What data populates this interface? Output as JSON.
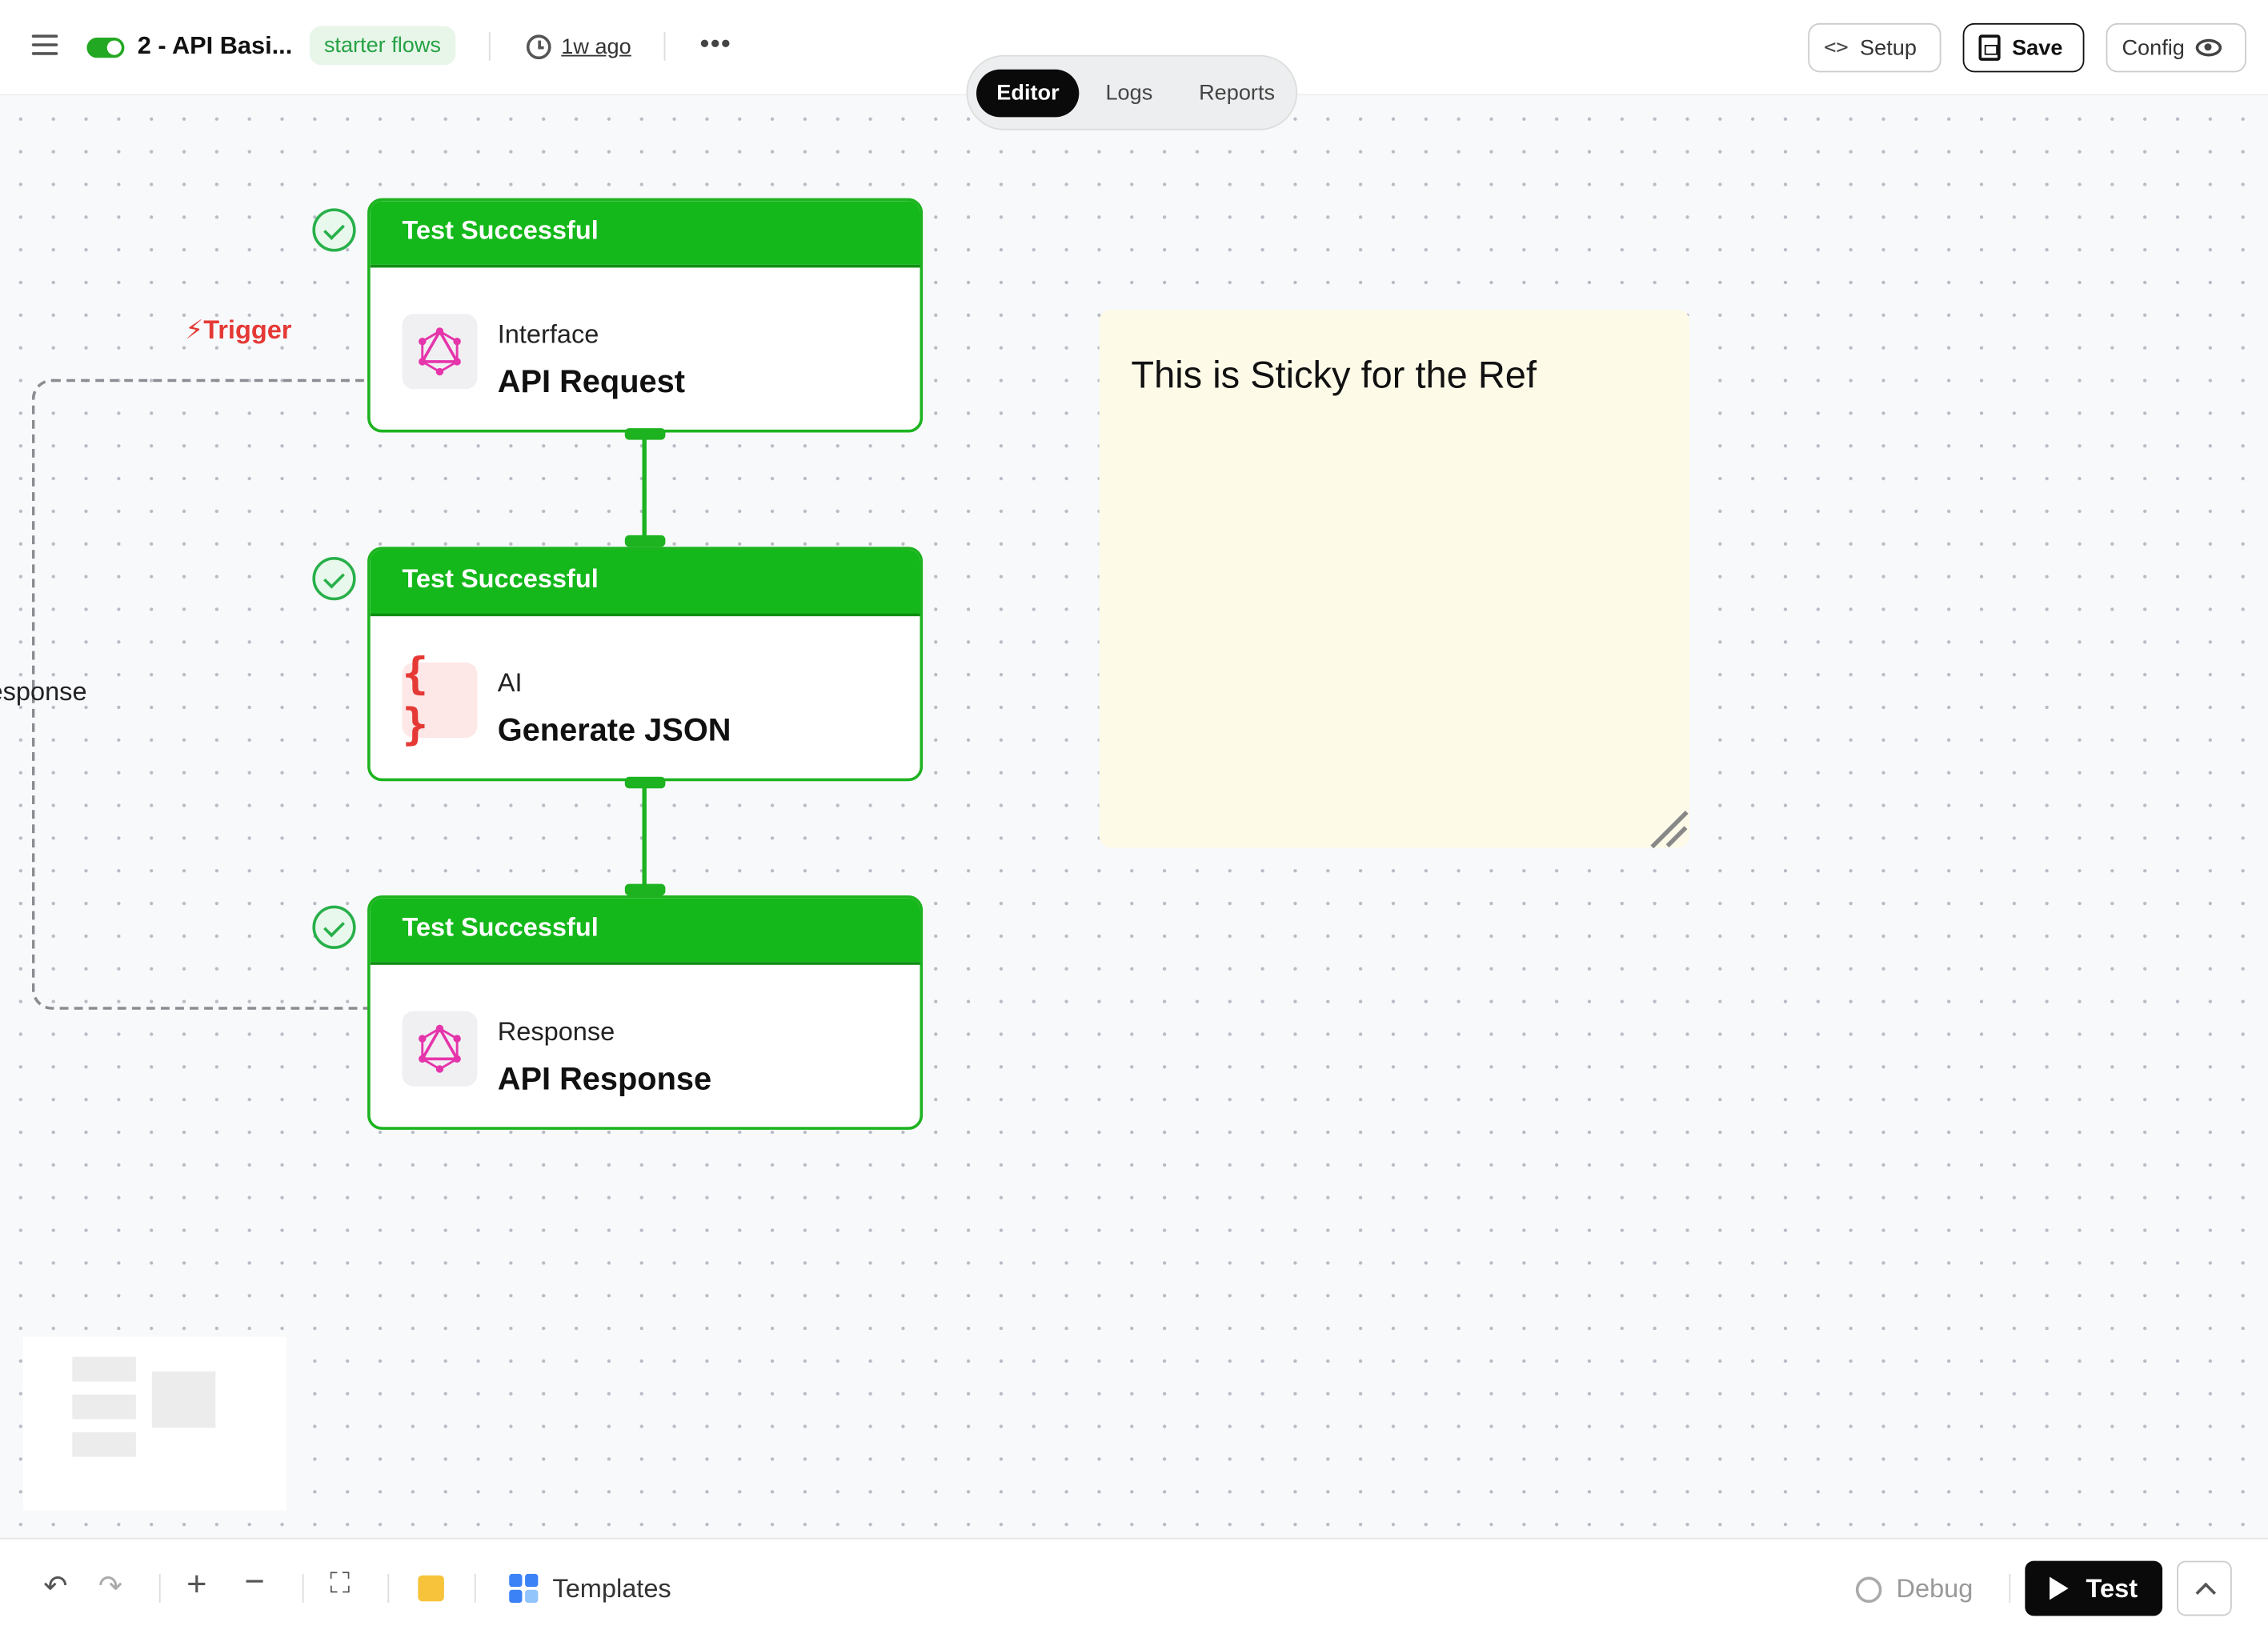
{
  "header": {
    "flow_title": "2 - API Basi...",
    "tag": "starter flows",
    "last_edited": "1w ago",
    "more": "•••",
    "setup_label": "Setup",
    "save_label": "Save",
    "config_label": "Config"
  },
  "tabs": [
    "Editor",
    "Logs",
    "Reports"
  ],
  "active_tab": "Editor",
  "canvas": {
    "trigger_label": "Trigger",
    "edge_label": "esponse",
    "nodes": [
      {
        "status": "Test Successful",
        "category": "Interface",
        "title": "API Request",
        "icon": "graphql-icon"
      },
      {
        "status": "Test Successful",
        "category": "AI",
        "title": "Generate JSON",
        "icon": "json-braces-icon"
      },
      {
        "status": "Test Successful",
        "category": "Response",
        "title": "API Response",
        "icon": "graphql-icon"
      }
    ],
    "sticky_note": "This is Sticky for the Ref"
  },
  "toolbar": {
    "templates_label": "Templates",
    "debug_label": "Debug",
    "test_label": "Test"
  },
  "colors": {
    "success_green": "#14b81a",
    "trigger_red": "#e53935",
    "sticky_bg": "#fdfae8",
    "tag_green": "#25a244"
  }
}
